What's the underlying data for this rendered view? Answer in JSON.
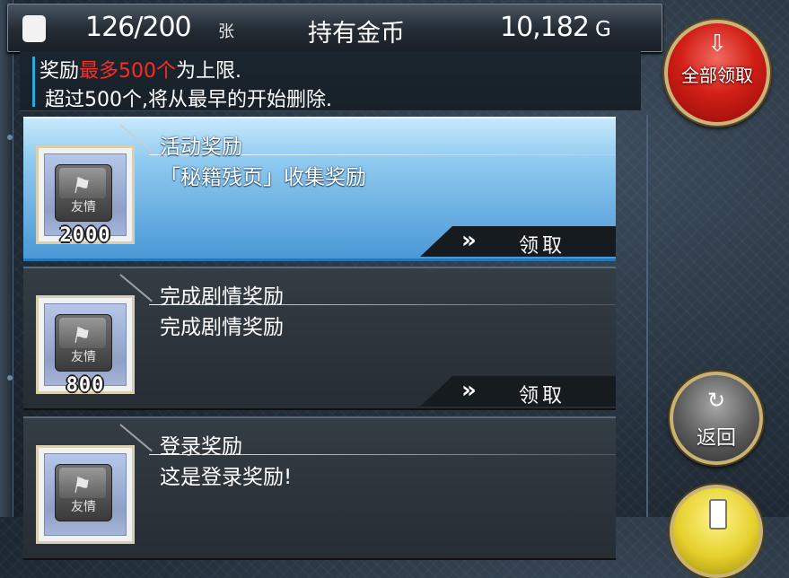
{
  "header": {
    "card_count": "126/200",
    "card_unit": "张",
    "coin_label": "持有金币",
    "coin_value": "10,182",
    "coin_unit": "G"
  },
  "notice": {
    "line1_prefix": "奖励",
    "line1_highlight": "最多500个",
    "line1_suffix": "为上限.",
    "line2": "超过500个,将从最早的开始删除.",
    "highlight_color": "#ff2a22"
  },
  "rewards": [
    {
      "title": "活动奖励",
      "description": "「秘籍残页」收集奖励",
      "item_label": "友情",
      "amount": "2000",
      "claim_label": "领取",
      "selected": true
    },
    {
      "title": "完成剧情奖励",
      "description": "完成剧情奖励",
      "item_label": "友情",
      "amount": "800",
      "claim_label": "领取",
      "selected": false
    },
    {
      "title": "登录奖励",
      "description": "这是登录奖励!",
      "item_label": "友情",
      "amount": "",
      "claim_label": "",
      "selected": false
    }
  ],
  "buttons": {
    "claim_all": "全部领取",
    "back": "返回"
  },
  "icons": {
    "claim_all": "download-arrow-icon",
    "back": "refresh-arrow-icon",
    "chevron": "double-chevron-right-icon",
    "card": "card-icon"
  },
  "colors": {
    "selected_row": "#8fcaf0",
    "claim_all_button": "#d21f17",
    "back_button": "#5a5a5a",
    "frame_gold": "#cbb37b"
  }
}
